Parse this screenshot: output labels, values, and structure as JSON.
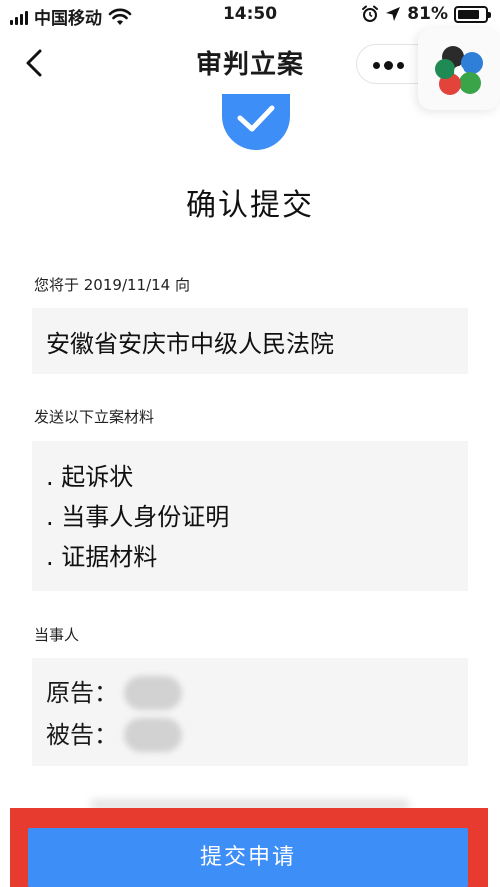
{
  "status_bar": {
    "carrier": "中国移动",
    "time": "14:50",
    "battery": "81%",
    "battery_level": 0.81
  },
  "nav": {
    "title": "审判立案"
  },
  "confirm": {
    "title": "确认提交"
  },
  "send_date_label": "您将于 2019/11/14 向",
  "court": "安徽省安庆市中级人民法院",
  "materials_label": "发送以下立案材料",
  "materials": [
    ". 起诉状",
    ". 当事人身份证明",
    ". 证据材料"
  ],
  "parties_label": "当事人",
  "parties": {
    "plaintiff_label": "原告：",
    "defendant_label": "被告："
  },
  "submit_label": "提交申请",
  "colors": {
    "accent": "#3e8ef7",
    "highlight": "#e63b2e",
    "box_bg": "#f5f5f5"
  }
}
